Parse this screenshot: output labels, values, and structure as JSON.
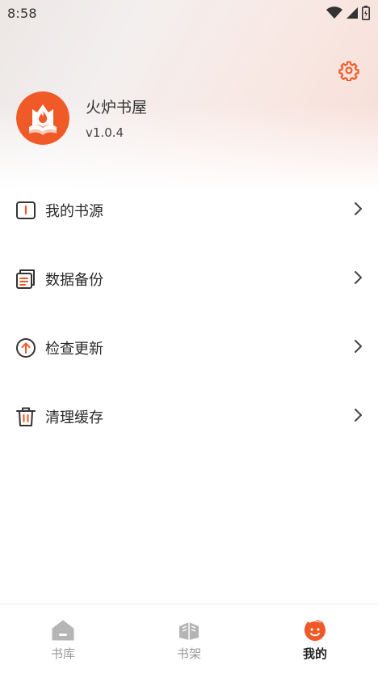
{
  "status_bar": {
    "time": "8:58",
    "icons": [
      "wifi-icon",
      "signal-icon",
      "battery-icon"
    ]
  },
  "header": {
    "settings_icon": "gear-icon",
    "app_name": "火炉书屋",
    "version": "v1.0.4",
    "avatar_icon": "flame-book-logo"
  },
  "menu": {
    "items": [
      {
        "label": "我的书源",
        "icon": "book-source-icon"
      },
      {
        "label": "数据备份",
        "icon": "backup-icon"
      },
      {
        "label": "检查更新",
        "icon": "update-icon"
      },
      {
        "label": "清理缓存",
        "icon": "trash-icon"
      }
    ]
  },
  "tabbar": {
    "tabs": [
      {
        "label": "书库",
        "icon": "home-icon",
        "active": false
      },
      {
        "label": "书架",
        "icon": "books-icon",
        "active": false
      },
      {
        "label": "我的",
        "icon": "profile-icon",
        "active": true
      }
    ]
  },
  "colors": {
    "accent": "#f05a28",
    "inactive_tab": "#9a9a9a",
    "text": "#2a2a2a"
  }
}
